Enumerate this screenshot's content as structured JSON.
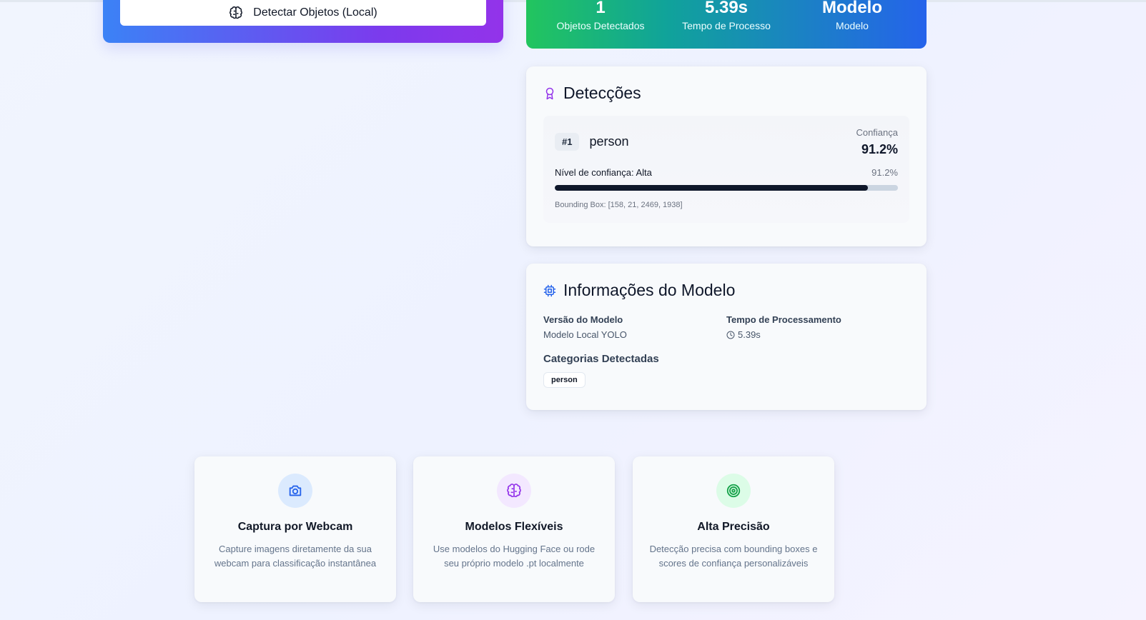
{
  "actions": {
    "detect_button_label": "Detectar Objetos (Local)"
  },
  "stats": [
    {
      "value": "1",
      "label": "Objetos Detectados"
    },
    {
      "value": "5.39s",
      "label": "Tempo de Processo"
    },
    {
      "value": "Modelo",
      "label": "Modelo"
    }
  ],
  "detections": {
    "title": "Detecções",
    "items": [
      {
        "rank": "#1",
        "name": "person",
        "confidence_label": "Confiança",
        "confidence_value": "91.2%",
        "confidence_fraction": 0.912,
        "level_label": "Nível de confiança: Alta",
        "level_pct": "91.2%",
        "bbox_text": "Bounding Box: [158, 21, 2469, 1938]"
      }
    ]
  },
  "model_info": {
    "title": "Informações do Modelo",
    "version_label": "Versão do Modelo",
    "version_value": "Modelo Local YOLO",
    "time_label": "Tempo de Processamento",
    "time_value": "5.39s",
    "categories_title": "Categorias Detectadas",
    "categories": [
      "person"
    ]
  },
  "features": [
    {
      "icon": "camera-icon",
      "title": "Captura por Webcam",
      "desc": "Capture imagens diretamente da sua webcam para classificação instantânea",
      "icon_bg": "#dbeafe",
      "icon_color": "#2563eb"
    },
    {
      "icon": "brain-icon",
      "title": "Modelos Flexíveis",
      "desc": "Use modelos do Hugging Face ou rode seu próprio modelo .pt localmente",
      "icon_bg": "#f3e8ff",
      "icon_color": "#9333ea"
    },
    {
      "icon": "target-icon",
      "title": "Alta Precisão",
      "desc": "Detecção precisa com bounding boxes e scores de confiança personalizáveis",
      "icon_bg": "#dcfce7",
      "icon_color": "#16a34a"
    }
  ],
  "colors": {
    "accent_purple": "#9333ea",
    "accent_blue": "#2563eb",
    "accent_green": "#22c55e"
  }
}
